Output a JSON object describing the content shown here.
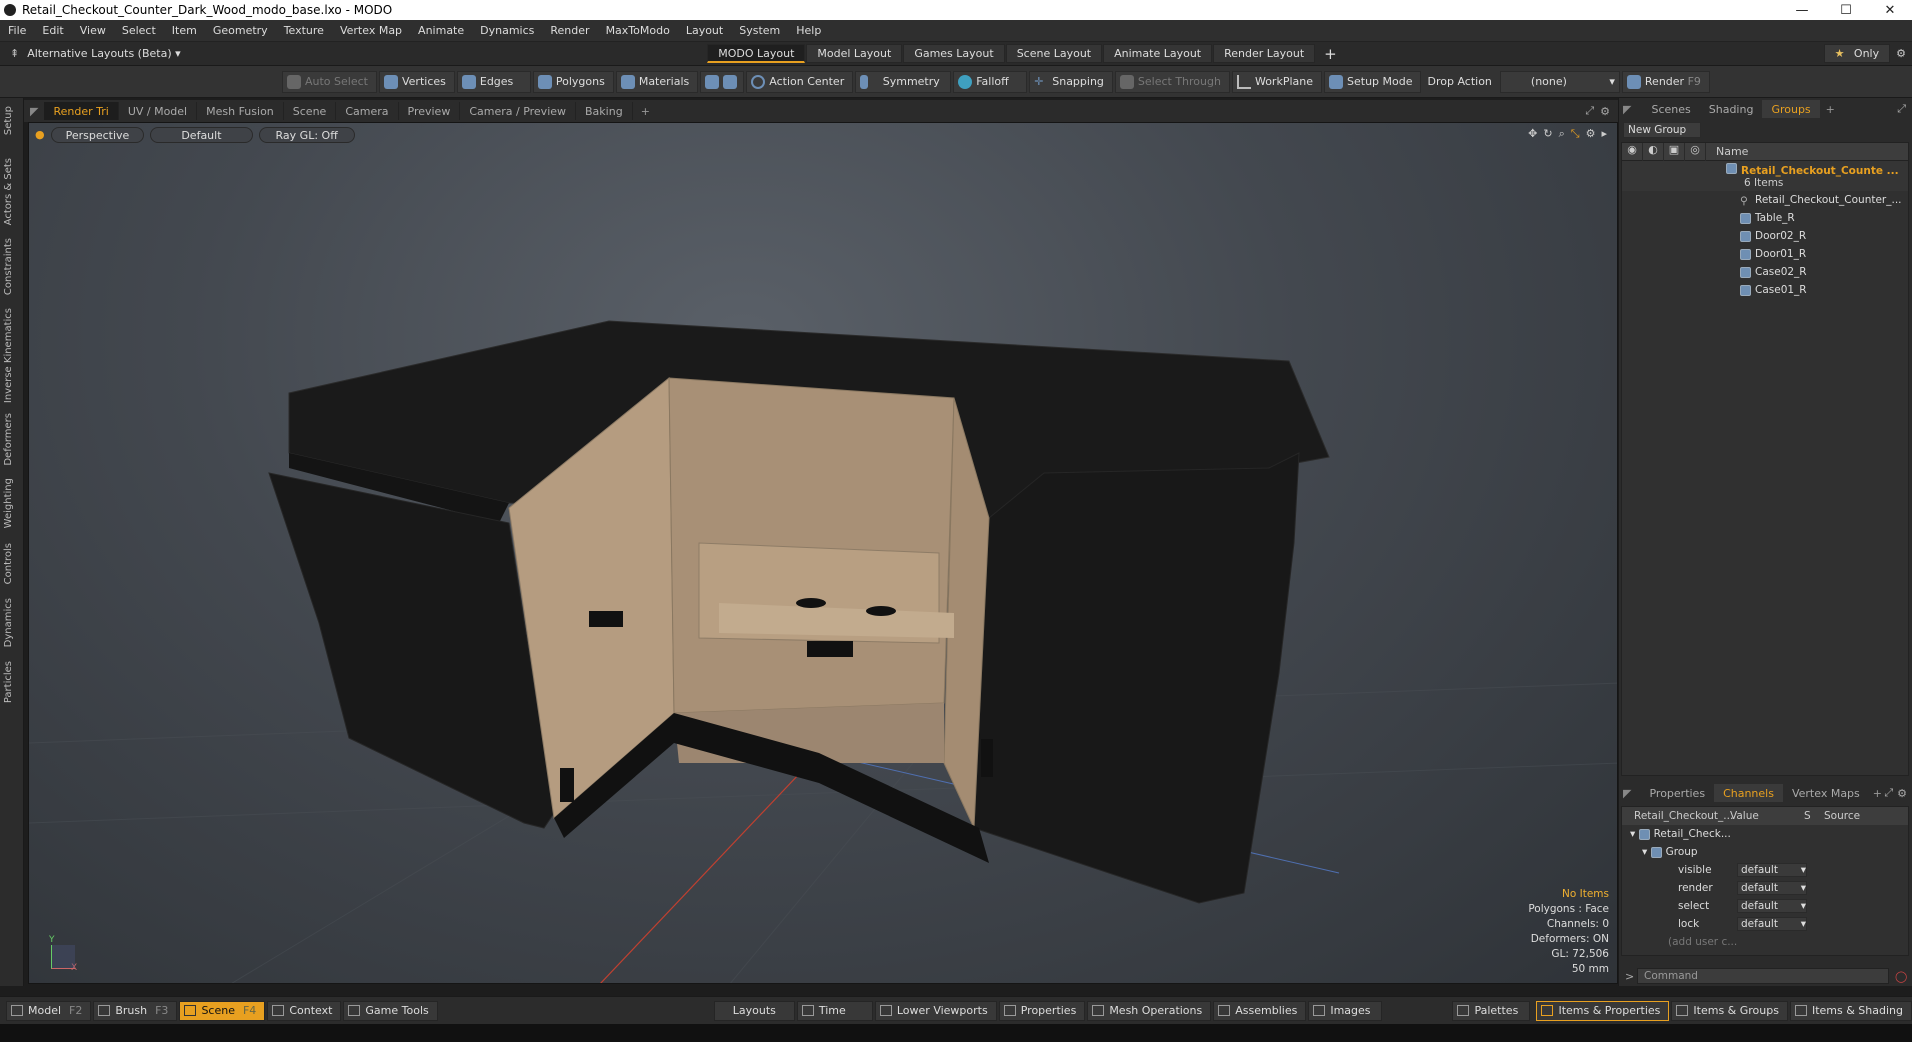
{
  "window": {
    "title": "Retail_Checkout_Counter_Dark_Wood_modo_base.lxo - MODO",
    "minimize": "—",
    "maximize": "☐",
    "close": "✕"
  },
  "menu": [
    "File",
    "Edit",
    "View",
    "Select",
    "Item",
    "Geometry",
    "Texture",
    "Vertex Map",
    "Animate",
    "Dynamics",
    "Render",
    "MaxToModo",
    "Layout",
    "System",
    "Help"
  ],
  "layouts": {
    "alt": "Alternative Layouts (Beta)",
    "tabs": [
      "MODO Layout",
      "Model Layout",
      "Games Layout",
      "Scene Layout",
      "Animate Layout",
      "Render Layout"
    ],
    "active": 0,
    "add": "+",
    "only": "Only"
  },
  "toolbar": {
    "auto_select": "Auto Select",
    "vertices": "Vertices",
    "edges": "Edges",
    "polygons": "Polygons",
    "materials": "Materials",
    "action_center": "Action Center",
    "symmetry": "Symmetry",
    "falloff": "Falloff",
    "snapping": "Snapping",
    "select_through": "Select Through",
    "workplane": "WorkPlane",
    "setup_mode": "Setup Mode",
    "drop_action": "Drop Action",
    "drop_value": "(none)",
    "render": "Render",
    "render_key": "F9"
  },
  "left_tabs": [
    "Setup",
    "Actors & Sets",
    "Constraints",
    "Inverse Kinematics",
    "Deformers",
    "Weighting",
    "Controls",
    "Dynamics",
    "Particles"
  ],
  "viewport_tabs": [
    "Render Tri",
    "UV / Model",
    "Mesh Fusion",
    "Scene",
    "Camera",
    "Preview",
    "Camera / Preview",
    "Baking"
  ],
  "viewport": {
    "view": "Perspective",
    "style": "Default",
    "raygl": "Ray GL: Off",
    "info": {
      "items": "No Items",
      "polygons": "Polygons : Face",
      "channels": "Channels: 0",
      "deformers": "Deformers: ON",
      "gl": "GL: 72,506",
      "focal": "50 mm"
    },
    "axis": {
      "y": "Y",
      "x": "X"
    }
  },
  "right_tabs": [
    "Scenes",
    "Shading",
    "Groups"
  ],
  "groups": {
    "new_group": "New Group",
    "name_header": "Name",
    "root": "Retail_Checkout_Counte ...",
    "count": "6 Items",
    "items": [
      "Retail_Checkout_Counter_...",
      "Table_R",
      "Door02_R",
      "Door01_R",
      "Case02_R",
      "Case01_R"
    ]
  },
  "lower_tabs": [
    "Properties",
    "Channels",
    "Vertex Maps"
  ],
  "channels": {
    "header": {
      "name": "Retail_Checkout_...",
      "value": "Value",
      "s": "S",
      "source": "Source"
    },
    "root": "Retail_Check...",
    "group": "Group",
    "rows": [
      {
        "name": "visible",
        "value": "default"
      },
      {
        "name": "render",
        "value": "default"
      },
      {
        "name": "select",
        "value": "default"
      },
      {
        "name": "lock",
        "value": "default"
      }
    ],
    "add": "(add user c..."
  },
  "command": {
    "prompt": ">",
    "placeholder": "Command"
  },
  "bottom": {
    "model": "Model",
    "model_key": "F2",
    "brush": "Brush",
    "brush_key": "F3",
    "scene": "Scene",
    "scene_key": "F4",
    "context": "Context",
    "game_tools": "Game Tools",
    "layouts": "Layouts",
    "time": "Time",
    "lower_viewports": "Lower Viewports",
    "properties": "Properties",
    "mesh_operations": "Mesh Operations",
    "assemblies": "Assemblies",
    "images": "Images",
    "palettes": "Palettes",
    "items_props": "Items & Properties",
    "items_groups": "Items & Groups",
    "items_shading": "Items & Shading"
  }
}
